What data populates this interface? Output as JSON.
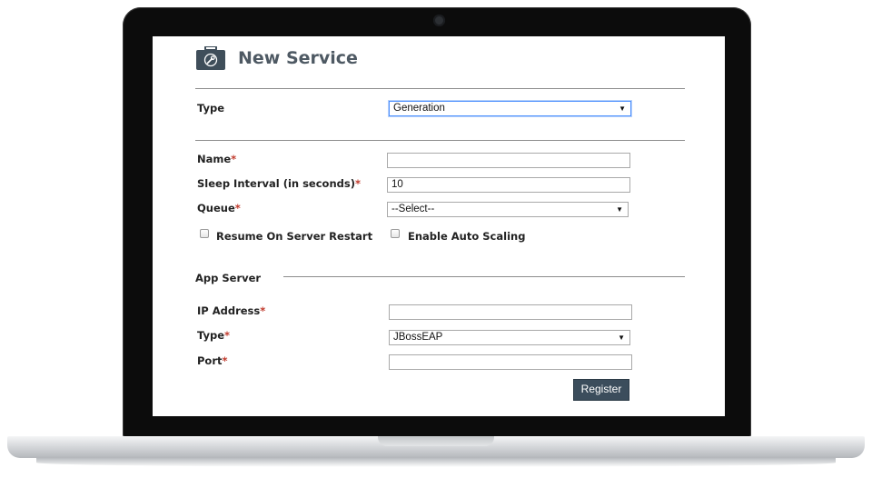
{
  "page": {
    "title": "New Service",
    "icon": "toolbox-wrench-icon"
  },
  "service_type": {
    "label": "Type",
    "value": "Generation"
  },
  "name": {
    "label": "Name",
    "required_mark": "*",
    "value": ""
  },
  "sleep_interval": {
    "label": "Sleep Interval (in seconds)",
    "required_mark": "*",
    "value": "10"
  },
  "queue": {
    "label": "Queue",
    "required_mark": "*",
    "value": "--Select--"
  },
  "options": {
    "resume_label": "Resume On Server Restart",
    "resume_checked": false,
    "autoscale_label": "Enable Auto Scaling",
    "autoscale_checked": false
  },
  "app_server": {
    "section_title": "App Server",
    "ip": {
      "label": "IP Address",
      "required_mark": "*",
      "value": ""
    },
    "type": {
      "label": "Type",
      "required_mark": "*",
      "value": "JBossEAP"
    },
    "port": {
      "label": "Port",
      "required_mark": "*",
      "value": ""
    }
  },
  "actions": {
    "register_label": "Register"
  },
  "colors": {
    "button_bg": "#3b4d5c",
    "required": "#c0392b",
    "title": "#4e5963",
    "focus": "#4d90fe"
  }
}
